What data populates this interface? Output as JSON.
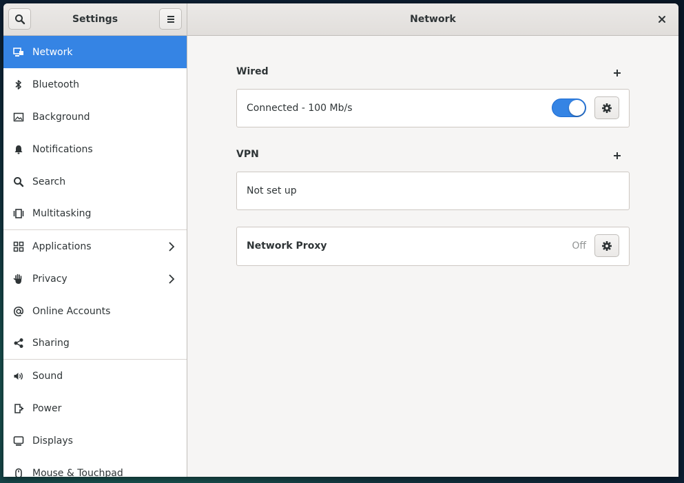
{
  "header": {
    "sidebar_title": "Settings",
    "panel_title": "Network"
  },
  "sidebar": {
    "items": [
      {
        "label": "Network",
        "icon": "network-icon"
      },
      {
        "label": "Bluetooth",
        "icon": "bluetooth-icon"
      },
      {
        "label": "Background",
        "icon": "background-icon"
      },
      {
        "label": "Notifications",
        "icon": "bell-icon"
      },
      {
        "label": "Search",
        "icon": "search-icon"
      },
      {
        "label": "Multitasking",
        "icon": "multitasking-icon"
      },
      {
        "label": "Applications",
        "icon": "applications-icon"
      },
      {
        "label": "Privacy",
        "icon": "hand-icon"
      },
      {
        "label": "Online Accounts",
        "icon": "at-icon"
      },
      {
        "label": "Sharing",
        "icon": "share-icon"
      },
      {
        "label": "Sound",
        "icon": "speaker-icon"
      },
      {
        "label": "Power",
        "icon": "power-icon"
      },
      {
        "label": "Displays",
        "icon": "display-icon"
      },
      {
        "label": "Mouse & Touchpad",
        "icon": "mouse-icon"
      }
    ]
  },
  "wired": {
    "title": "Wired",
    "status": "Connected - 100 Mb/s",
    "enabled": true
  },
  "vpn": {
    "title": "VPN",
    "status": "Not set up"
  },
  "proxy": {
    "label": "Network Proxy",
    "status": "Off"
  },
  "colors": {
    "accent": "#3584e4",
    "sidebar_bg": "#ffffff",
    "content_bg": "#f6f5f4"
  }
}
